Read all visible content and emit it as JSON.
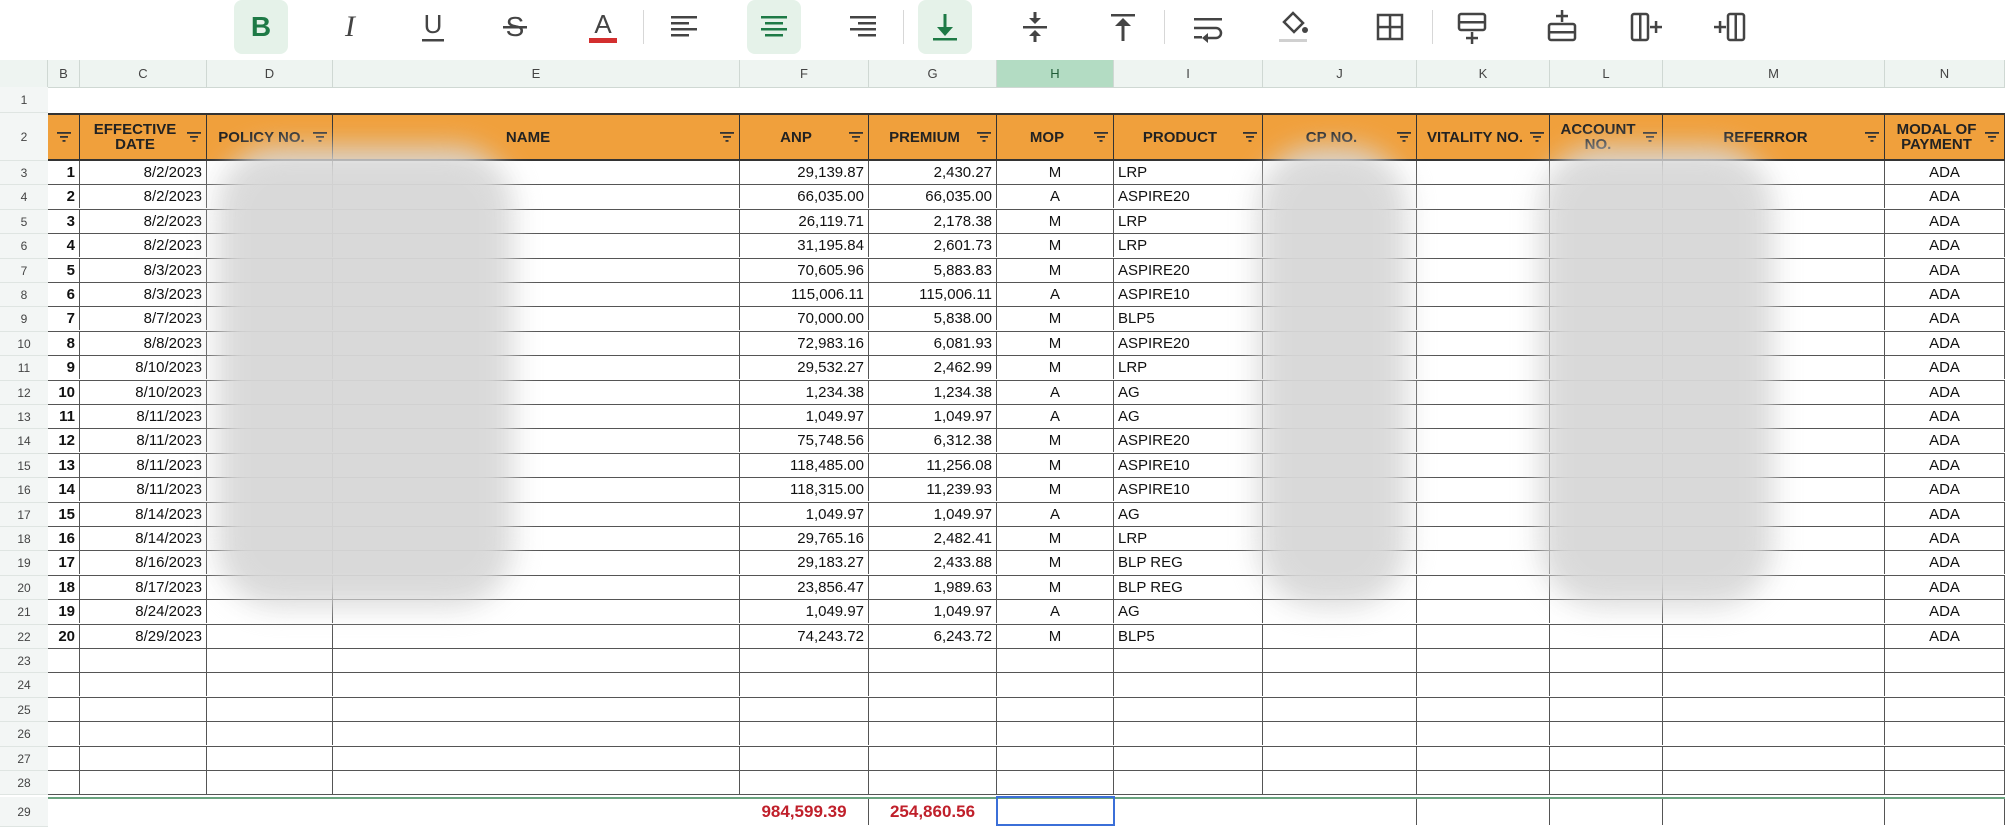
{
  "toolbar": {
    "buttons": [
      {
        "name": "bold-icon",
        "active": true
      },
      {
        "name": "italic-icon",
        "active": false
      },
      {
        "name": "underline-icon",
        "active": false
      },
      {
        "name": "strikethrough-icon",
        "active": false
      },
      {
        "name": "text-color-icon",
        "active": false
      },
      {
        "name": "align-left-icon",
        "active": false
      },
      {
        "name": "align-center-icon",
        "active": true
      },
      {
        "name": "align-right-icon",
        "active": false
      },
      {
        "name": "valign-bottom-icon",
        "active": true
      },
      {
        "name": "valign-middle-icon",
        "active": false
      },
      {
        "name": "valign-top-icon",
        "active": false
      },
      {
        "name": "wrap-text-icon",
        "active": false
      },
      {
        "name": "fill-color-icon",
        "active": false
      },
      {
        "name": "borders-icon",
        "active": false
      },
      {
        "name": "insert-row-below-icon",
        "active": false
      },
      {
        "name": "insert-row-above-icon",
        "active": false
      },
      {
        "name": "insert-column-right-icon",
        "active": false
      },
      {
        "name": "insert-column-left-icon",
        "active": false
      }
    ],
    "text_color": "#d32f2f",
    "active_color": "#1e7a46"
  },
  "column_letters": [
    "B",
    "C",
    "D",
    "E",
    "F",
    "G",
    "H",
    "I",
    "J",
    "K",
    "L",
    "M",
    "N"
  ],
  "selected_column": "H",
  "row_numbers": [
    "1",
    "2",
    "3",
    "4",
    "5",
    "6",
    "7",
    "8",
    "9",
    "10",
    "11",
    "12",
    "13",
    "14",
    "15",
    "16",
    "17",
    "18",
    "19",
    "20",
    "21",
    "22",
    "23",
    "24",
    "25",
    "26",
    "27",
    "28",
    "29"
  ],
  "header": {
    "color": "#f0a03c",
    "labels": [
      "",
      "EFFECTIVE DATE",
      "POLICY NO.",
      "NAME",
      "ANP",
      "PREMIUM",
      "MOP",
      "PRODUCT",
      "CP NO.",
      "VITALITY NO.",
      "ACCOUNT NO.",
      "REFERROR",
      "MODAL OF PAYMENT"
    ]
  },
  "rows": [
    {
      "no": "1",
      "date": "8/2/2023",
      "anp": "29,139.87",
      "premium": "2,430.27",
      "mop": "M",
      "product": "LRP",
      "modal": "ADA"
    },
    {
      "no": "2",
      "date": "8/2/2023",
      "anp": "66,035.00",
      "premium": "66,035.00",
      "mop": "A",
      "product": "ASPIRE20",
      "modal": "ADA"
    },
    {
      "no": "3",
      "date": "8/2/2023",
      "anp": "26,119.71",
      "premium": "2,178.38",
      "mop": "M",
      "product": "LRP",
      "modal": "ADA"
    },
    {
      "no": "4",
      "date": "8/2/2023",
      "anp": "31,195.84",
      "premium": "2,601.73",
      "mop": "M",
      "product": "LRP",
      "modal": "ADA"
    },
    {
      "no": "5",
      "date": "8/3/2023",
      "anp": "70,605.96",
      "premium": "5,883.83",
      "mop": "M",
      "product": "ASPIRE20",
      "modal": "ADA"
    },
    {
      "no": "6",
      "date": "8/3/2023",
      "anp": "115,006.11",
      "premium": "115,006.11",
      "mop": "A",
      "product": "ASPIRE10",
      "modal": "ADA"
    },
    {
      "no": "7",
      "date": "8/7/2023",
      "anp": "70,000.00",
      "premium": "5,838.00",
      "mop": "M",
      "product": "BLP5",
      "modal": "ADA"
    },
    {
      "no": "8",
      "date": "8/8/2023",
      "anp": "72,983.16",
      "premium": "6,081.93",
      "mop": "M",
      "product": "ASPIRE20",
      "modal": "ADA"
    },
    {
      "no": "9",
      "date": "8/10/2023",
      "anp": "29,532.27",
      "premium": "2,462.99",
      "mop": "M",
      "product": "LRP",
      "modal": "ADA"
    },
    {
      "no": "10",
      "date": "8/10/2023",
      "anp": "1,234.38",
      "premium": "1,234.38",
      "mop": "A",
      "product": "AG",
      "modal": "ADA"
    },
    {
      "no": "11",
      "date": "8/11/2023",
      "anp": "1,049.97",
      "premium": "1,049.97",
      "mop": "A",
      "product": "AG",
      "modal": "ADA"
    },
    {
      "no": "12",
      "date": "8/11/2023",
      "anp": "75,748.56",
      "premium": "6,312.38",
      "mop": "M",
      "product": "ASPIRE20",
      "modal": "ADA"
    },
    {
      "no": "13",
      "date": "8/11/2023",
      "anp": "118,485.00",
      "premium": "11,256.08",
      "mop": "M",
      "product": "ASPIRE10",
      "modal": "ADA"
    },
    {
      "no": "14",
      "date": "8/11/2023",
      "anp": "118,315.00",
      "premium": "11,239.93",
      "mop": "M",
      "product": "ASPIRE10",
      "modal": "ADA"
    },
    {
      "no": "15",
      "date": "8/14/2023",
      "anp": "1,049.97",
      "premium": "1,049.97",
      "mop": "A",
      "product": "AG",
      "modal": "ADA"
    },
    {
      "no": "16",
      "date": "8/14/2023",
      "anp": "29,765.16",
      "premium": "2,482.41",
      "mop": "M",
      "product": "LRP",
      "modal": "ADA"
    },
    {
      "no": "17",
      "date": "8/16/2023",
      "anp": "29,183.27",
      "premium": "2,433.88",
      "mop": "M",
      "product": "BLP REG",
      "modal": "ADA"
    },
    {
      "no": "18",
      "date": "8/17/2023",
      "anp": "23,856.47",
      "premium": "1,989.63",
      "mop": "M",
      "product": "BLP REG",
      "modal": "ADA"
    },
    {
      "no": "19",
      "date": "8/24/2023",
      "anp": "1,049.97",
      "premium": "1,049.97",
      "mop": "A",
      "product": "AG",
      "modal": "ADA"
    },
    {
      "no": "20",
      "date": "8/29/2023",
      "anp": "74,243.72",
      "premium": "6,243.72",
      "mop": "M",
      "product": "BLP5",
      "modal": "ADA"
    }
  ],
  "totals": {
    "anp": "984,599.39",
    "premium": "254,860.56",
    "color": "#c0202b"
  }
}
